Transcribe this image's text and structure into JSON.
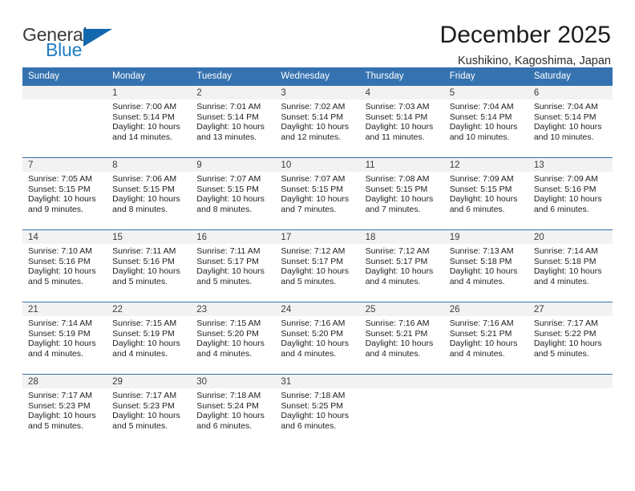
{
  "logo": {
    "word_one": "General",
    "word_two": "Blue",
    "triangle_icon": "triangle-icon",
    "accent_color": "#1368ad"
  },
  "header": {
    "title": "December 2025",
    "subtitle": "Kushikino, Kagoshima, Japan"
  },
  "calendar": {
    "header_color": "#3572b0",
    "weekday_headers": [
      "Sunday",
      "Monday",
      "Tuesday",
      "Wednesday",
      "Thursday",
      "Friday",
      "Saturday"
    ],
    "weeks": [
      [
        {
          "day": "",
          "sunrise": "",
          "sunset": "",
          "daylight_1": "",
          "daylight_2": ""
        },
        {
          "day": "1",
          "sunrise": "Sunrise: 7:00 AM",
          "sunset": "Sunset: 5:14 PM",
          "daylight_1": "Daylight: 10 hours",
          "daylight_2": "and 14 minutes."
        },
        {
          "day": "2",
          "sunrise": "Sunrise: 7:01 AM",
          "sunset": "Sunset: 5:14 PM",
          "daylight_1": "Daylight: 10 hours",
          "daylight_2": "and 13 minutes."
        },
        {
          "day": "3",
          "sunrise": "Sunrise: 7:02 AM",
          "sunset": "Sunset: 5:14 PM",
          "daylight_1": "Daylight: 10 hours",
          "daylight_2": "and 12 minutes."
        },
        {
          "day": "4",
          "sunrise": "Sunrise: 7:03 AM",
          "sunset": "Sunset: 5:14 PM",
          "daylight_1": "Daylight: 10 hours",
          "daylight_2": "and 11 minutes."
        },
        {
          "day": "5",
          "sunrise": "Sunrise: 7:04 AM",
          "sunset": "Sunset: 5:14 PM",
          "daylight_1": "Daylight: 10 hours",
          "daylight_2": "and 10 minutes."
        },
        {
          "day": "6",
          "sunrise": "Sunrise: 7:04 AM",
          "sunset": "Sunset: 5:14 PM",
          "daylight_1": "Daylight: 10 hours",
          "daylight_2": "and 10 minutes."
        }
      ],
      [
        {
          "day": "7",
          "sunrise": "Sunrise: 7:05 AM",
          "sunset": "Sunset: 5:15 PM",
          "daylight_1": "Daylight: 10 hours",
          "daylight_2": "and 9 minutes."
        },
        {
          "day": "8",
          "sunrise": "Sunrise: 7:06 AM",
          "sunset": "Sunset: 5:15 PM",
          "daylight_1": "Daylight: 10 hours",
          "daylight_2": "and 8 minutes."
        },
        {
          "day": "9",
          "sunrise": "Sunrise: 7:07 AM",
          "sunset": "Sunset: 5:15 PM",
          "daylight_1": "Daylight: 10 hours",
          "daylight_2": "and 8 minutes."
        },
        {
          "day": "10",
          "sunrise": "Sunrise: 7:07 AM",
          "sunset": "Sunset: 5:15 PM",
          "daylight_1": "Daylight: 10 hours",
          "daylight_2": "and 7 minutes."
        },
        {
          "day": "11",
          "sunrise": "Sunrise: 7:08 AM",
          "sunset": "Sunset: 5:15 PM",
          "daylight_1": "Daylight: 10 hours",
          "daylight_2": "and 7 minutes."
        },
        {
          "day": "12",
          "sunrise": "Sunrise: 7:09 AM",
          "sunset": "Sunset: 5:15 PM",
          "daylight_1": "Daylight: 10 hours",
          "daylight_2": "and 6 minutes."
        },
        {
          "day": "13",
          "sunrise": "Sunrise: 7:09 AM",
          "sunset": "Sunset: 5:16 PM",
          "daylight_1": "Daylight: 10 hours",
          "daylight_2": "and 6 minutes."
        }
      ],
      [
        {
          "day": "14",
          "sunrise": "Sunrise: 7:10 AM",
          "sunset": "Sunset: 5:16 PM",
          "daylight_1": "Daylight: 10 hours",
          "daylight_2": "and 5 minutes."
        },
        {
          "day": "15",
          "sunrise": "Sunrise: 7:11 AM",
          "sunset": "Sunset: 5:16 PM",
          "daylight_1": "Daylight: 10 hours",
          "daylight_2": "and 5 minutes."
        },
        {
          "day": "16",
          "sunrise": "Sunrise: 7:11 AM",
          "sunset": "Sunset: 5:17 PM",
          "daylight_1": "Daylight: 10 hours",
          "daylight_2": "and 5 minutes."
        },
        {
          "day": "17",
          "sunrise": "Sunrise: 7:12 AM",
          "sunset": "Sunset: 5:17 PM",
          "daylight_1": "Daylight: 10 hours",
          "daylight_2": "and 5 minutes."
        },
        {
          "day": "18",
          "sunrise": "Sunrise: 7:12 AM",
          "sunset": "Sunset: 5:17 PM",
          "daylight_1": "Daylight: 10 hours",
          "daylight_2": "and 4 minutes."
        },
        {
          "day": "19",
          "sunrise": "Sunrise: 7:13 AM",
          "sunset": "Sunset: 5:18 PM",
          "daylight_1": "Daylight: 10 hours",
          "daylight_2": "and 4 minutes."
        },
        {
          "day": "20",
          "sunrise": "Sunrise: 7:14 AM",
          "sunset": "Sunset: 5:18 PM",
          "daylight_1": "Daylight: 10 hours",
          "daylight_2": "and 4 minutes."
        }
      ],
      [
        {
          "day": "21",
          "sunrise": "Sunrise: 7:14 AM",
          "sunset": "Sunset: 5:19 PM",
          "daylight_1": "Daylight: 10 hours",
          "daylight_2": "and 4 minutes."
        },
        {
          "day": "22",
          "sunrise": "Sunrise: 7:15 AM",
          "sunset": "Sunset: 5:19 PM",
          "daylight_1": "Daylight: 10 hours",
          "daylight_2": "and 4 minutes."
        },
        {
          "day": "23",
          "sunrise": "Sunrise: 7:15 AM",
          "sunset": "Sunset: 5:20 PM",
          "daylight_1": "Daylight: 10 hours",
          "daylight_2": "and 4 minutes."
        },
        {
          "day": "24",
          "sunrise": "Sunrise: 7:16 AM",
          "sunset": "Sunset: 5:20 PM",
          "daylight_1": "Daylight: 10 hours",
          "daylight_2": "and 4 minutes."
        },
        {
          "day": "25",
          "sunrise": "Sunrise: 7:16 AM",
          "sunset": "Sunset: 5:21 PM",
          "daylight_1": "Daylight: 10 hours",
          "daylight_2": "and 4 minutes."
        },
        {
          "day": "26",
          "sunrise": "Sunrise: 7:16 AM",
          "sunset": "Sunset: 5:21 PM",
          "daylight_1": "Daylight: 10 hours",
          "daylight_2": "and 4 minutes."
        },
        {
          "day": "27",
          "sunrise": "Sunrise: 7:17 AM",
          "sunset": "Sunset: 5:22 PM",
          "daylight_1": "Daylight: 10 hours",
          "daylight_2": "and 5 minutes."
        }
      ],
      [
        {
          "day": "28",
          "sunrise": "Sunrise: 7:17 AM",
          "sunset": "Sunset: 5:23 PM",
          "daylight_1": "Daylight: 10 hours",
          "daylight_2": "and 5 minutes."
        },
        {
          "day": "29",
          "sunrise": "Sunrise: 7:17 AM",
          "sunset": "Sunset: 5:23 PM",
          "daylight_1": "Daylight: 10 hours",
          "daylight_2": "and 5 minutes."
        },
        {
          "day": "30",
          "sunrise": "Sunrise: 7:18 AM",
          "sunset": "Sunset: 5:24 PM",
          "daylight_1": "Daylight: 10 hours",
          "daylight_2": "and 6 minutes."
        },
        {
          "day": "31",
          "sunrise": "Sunrise: 7:18 AM",
          "sunset": "Sunset: 5:25 PM",
          "daylight_1": "Daylight: 10 hours",
          "daylight_2": "and 6 minutes."
        },
        {
          "day": "",
          "sunrise": "",
          "sunset": "",
          "daylight_1": "",
          "daylight_2": ""
        },
        {
          "day": "",
          "sunrise": "",
          "sunset": "",
          "daylight_1": "",
          "daylight_2": ""
        },
        {
          "day": "",
          "sunrise": "",
          "sunset": "",
          "daylight_1": "",
          "daylight_2": ""
        }
      ]
    ]
  }
}
